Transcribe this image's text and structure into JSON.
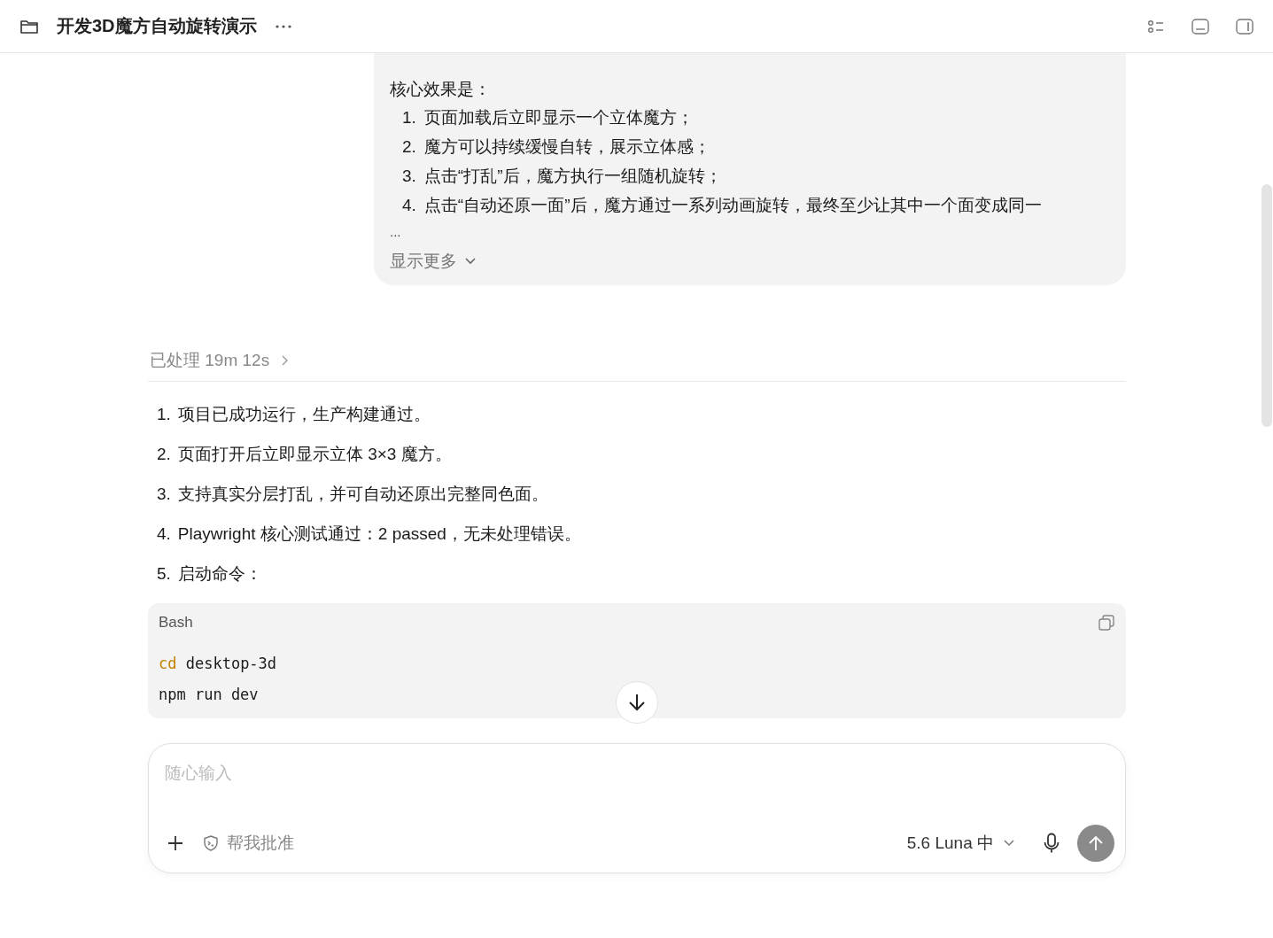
{
  "header": {
    "title": "开发3D魔方自动旋转演示"
  },
  "user_message": {
    "intro": "核心效果是：",
    "items": [
      {
        "number": "1.",
        "text": "页面加载后立即显示一个立体魔方；"
      },
      {
        "number": "2.",
        "text": "魔方可以持续缓慢自转，展示立体感；"
      },
      {
        "number": "3.",
        "text": "点击“打乱”后，魔方执行一组随机旋转；"
      },
      {
        "number": "4.",
        "text": "点击“自动还原一面”后，魔方通过一系列动画旋转，最终至少让其中一个面变成同一"
      }
    ],
    "ellipsis": "...",
    "show_more": "显示更多"
  },
  "processed": {
    "label": "已处理 19m 12s"
  },
  "answer": {
    "items": [
      {
        "number": "1.",
        "text": "项目已成功运行，生产构建通过。"
      },
      {
        "number": "2.",
        "text": "页面打开后立即显示立体 3×3 魔方。"
      },
      {
        "number": "3.",
        "text": "支持真实分层打乱，并可自动还原出完整同色面。"
      },
      {
        "number": "4.",
        "text": "Playwright 核心测试通过：2 passed，无未处理错误。"
      },
      {
        "number": "5.",
        "text": "启动命令："
      }
    ]
  },
  "code_block": {
    "language": "Bash",
    "lines": [
      [
        {
          "kind": "keyword",
          "text": "cd"
        },
        {
          "kind": "plain",
          "text": " desktop-3d"
        }
      ],
      [
        {
          "kind": "plain",
          "text": "npm run dev"
        }
      ]
    ]
  },
  "composer": {
    "placeholder": "随心输入",
    "approve": "帮我批准",
    "model": "5.6 Luna 中"
  }
}
